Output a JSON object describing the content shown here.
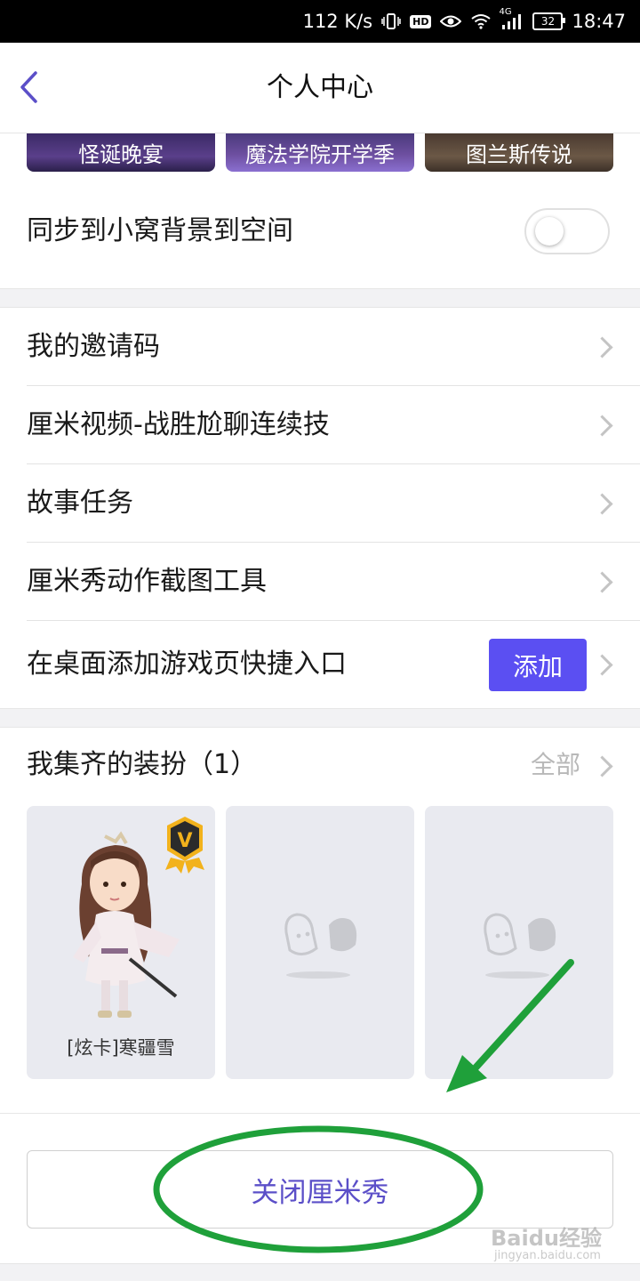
{
  "status_bar": {
    "speed": "112 K/s",
    "hd": "HD",
    "network": "4G",
    "battery": "32",
    "time": "18:47"
  },
  "nav": {
    "title": "个人中心",
    "back_icon": "chevron-left-icon"
  },
  "themes": [
    {
      "label": "怪诞晚宴"
    },
    {
      "label": "魔法学院开学季"
    },
    {
      "label": "图兰斯传说"
    }
  ],
  "sync": {
    "label": "同步到小窝背景到空间",
    "enabled": false
  },
  "menu": [
    {
      "label": "我的邀请码"
    },
    {
      "label": "厘米视频-战胜尬聊连续技"
    },
    {
      "label": "故事任务"
    },
    {
      "label": "厘米秀动作截图工具"
    },
    {
      "label": "在桌面添加游戏页快捷入口",
      "button": "添加"
    }
  ],
  "collection": {
    "title": "我集齐的装扮（1）",
    "all_label": "全部",
    "items": [
      {
        "name": "[炫卡]寒疆雪",
        "badge": "V"
      },
      {
        "name": ""
      },
      {
        "name": ""
      }
    ]
  },
  "close_button": "关闭厘米秀",
  "watermark": {
    "line1": "Baidu经验",
    "line2": "jingyan.baidu.com"
  },
  "colors": {
    "accent": "#5b4ff2",
    "annotation": "#1fa03a",
    "badge_gold": "#f2b21c"
  }
}
